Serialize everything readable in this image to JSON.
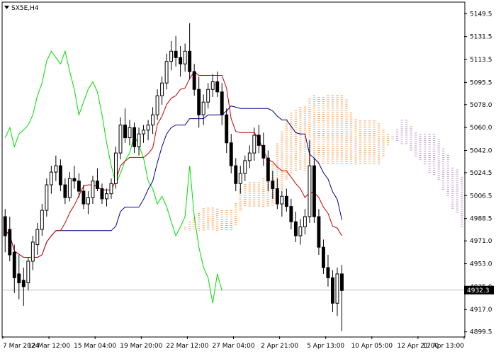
{
  "window": {
    "symbol_title": "SX5E,H4",
    "colors": {
      "background": "#ffffff",
      "frame": "#000000",
      "bull_candle": "#000000",
      "bear_candle": "#000000",
      "tenkan": "#cc0000",
      "kijun": "#00008b",
      "chikou": "#00dd00",
      "cloud": "#f4a460",
      "cloud_bear": "#c0a0c8",
      "current_price_line": "#c0c0c0",
      "price_tag_bg": "#000000",
      "price_tag_text": "#ffffff"
    }
  },
  "chart_data": {
    "type": "candlestick",
    "title": "SX5E,H4",
    "y_ticks": [
      "5149.5",
      "5131.5",
      "5113.5",
      "5095.5",
      "5078.0",
      "5060.0",
      "5042.0",
      "5024.5",
      "5006.5",
      "4988.5",
      "4971.0",
      "4953.0",
      "4935.0",
      "4917.0",
      "4899.5"
    ],
    "x_ticks": [
      "7 Mar 2024",
      "12 Mar 12:00",
      "15 Mar 04:00",
      "19 Mar 20:00",
      "22 Mar 12:00",
      "27 Mar 04:00",
      "2 Apr 21:00",
      "5 Apr 13:00",
      "10 Apr 05:00",
      "12 Apr 21:00",
      "17 Apr 13:00"
    ],
    "ylim": [
      4896,
      5158
    ],
    "current_price": "4932.3",
    "current_price_value": 4932.3,
    "ohlc": [
      [
        4990,
        4996,
        4962,
        4975
      ],
      [
        4980,
        4990,
        4955,
        4960
      ],
      [
        4962,
        4968,
        4930,
        4942
      ],
      [
        4945,
        4960,
        4925,
        4938
      ],
      [
        4940,
        4950,
        4920,
        4935
      ],
      [
        4938,
        4958,
        4932,
        4955
      ],
      [
        4955,
        4975,
        4948,
        4970
      ],
      [
        4968,
        4985,
        4960,
        4980
      ],
      [
        4980,
        5000,
        4975,
        4995
      ],
      [
        4995,
        5020,
        4990,
        5015
      ],
      [
        5015,
        5030,
        5008,
        5025
      ],
      [
        5025,
        5038,
        5018,
        5030
      ],
      [
        5030,
        5035,
        5010,
        5015
      ],
      [
        5015,
        5020,
        5000,
        5005
      ],
      [
        5005,
        5025,
        5002,
        5020
      ],
      [
        5020,
        5030,
        5012,
        5018
      ],
      [
        5018,
        5024,
        5005,
        5010
      ],
      [
        5010,
        5015,
        4996,
        5000
      ],
      [
        5000,
        5010,
        4992,
        5005
      ],
      [
        5005,
        5022,
        5000,
        5018
      ],
      [
        5018,
        5028,
        5010,
        5012
      ],
      [
        5012,
        5016,
        5000,
        5004
      ],
      [
        5004,
        5012,
        4998,
        5008
      ],
      [
        5008,
        5020,
        5004,
        5016
      ],
      [
        5016,
        5045,
        5012,
        5040
      ],
      [
        5040,
        5068,
        5035,
        5062
      ],
      [
        5062,
        5075,
        5048,
        5052
      ],
      [
        5052,
        5066,
        5046,
        5060
      ],
      [
        5060,
        5064,
        5040,
        5045
      ],
      [
        5045,
        5060,
        5038,
        5055
      ],
      [
        5055,
        5062,
        5048,
        5058
      ],
      [
        5058,
        5066,
        5050,
        5062
      ],
      [
        5062,
        5076,
        5055,
        5070
      ],
      [
        5070,
        5090,
        5066,
        5085
      ],
      [
        5085,
        5100,
        5078,
        5095
      ],
      [
        5095,
        5118,
        5090,
        5112
      ],
      [
        5112,
        5128,
        5105,
        5120
      ],
      [
        5120,
        5132,
        5108,
        5115
      ],
      [
        5115,
        5124,
        5100,
        5110
      ],
      [
        5110,
        5126,
        5104,
        5120
      ],
      [
        5120,
        5142,
        5098,
        5104
      ],
      [
        5104,
        5110,
        5085,
        5090
      ],
      [
        5090,
        5100,
        5060,
        5070
      ],
      [
        5070,
        5086,
        5062,
        5080
      ],
      [
        5080,
        5095,
        5075,
        5090
      ],
      [
        5090,
        5102,
        5084,
        5096
      ],
      [
        5096,
        5104,
        5084,
        5088
      ],
      [
        5088,
        5095,
        5062,
        5070
      ],
      [
        5070,
        5075,
        5040,
        5048
      ],
      [
        5048,
        5055,
        5024,
        5030
      ],
      [
        5030,
        5036,
        5010,
        5016
      ],
      [
        5016,
        5030,
        5008,
        5024
      ],
      [
        5024,
        5038,
        5018,
        5034
      ],
      [
        5034,
        5046,
        5028,
        5040
      ],
      [
        5040,
        5060,
        5034,
        5054
      ],
      [
        5054,
        5062,
        5040,
        5046
      ],
      [
        5046,
        5056,
        5030,
        5036
      ],
      [
        5036,
        5042,
        5010,
        5018
      ],
      [
        5018,
        5026,
        5004,
        5012
      ],
      [
        5012,
        5020,
        4996,
        5000
      ],
      [
        5000,
        5010,
        4990,
        5006
      ],
      [
        5006,
        5012,
        4994,
        4998
      ],
      [
        4998,
        5004,
        4980,
        4986
      ],
      [
        4986,
        4994,
        4970,
        4975
      ],
      [
        4975,
        4988,
        4968,
        4982
      ],
      [
        4982,
        4996,
        4976,
        4990
      ],
      [
        4990,
        5050,
        4985,
        5030
      ],
      [
        5030,
        5036,
        4985,
        4990
      ],
      [
        4990,
        4996,
        4960,
        4966
      ],
      [
        4966,
        4972,
        4945,
        4950
      ],
      [
        4950,
        4960,
        4935,
        4942
      ],
      [
        4942,
        4948,
        4915,
        4922
      ],
      [
        4922,
        4950,
        4912,
        4945
      ],
      [
        4945,
        4952,
        4900,
        4932
      ]
    ]
  }
}
